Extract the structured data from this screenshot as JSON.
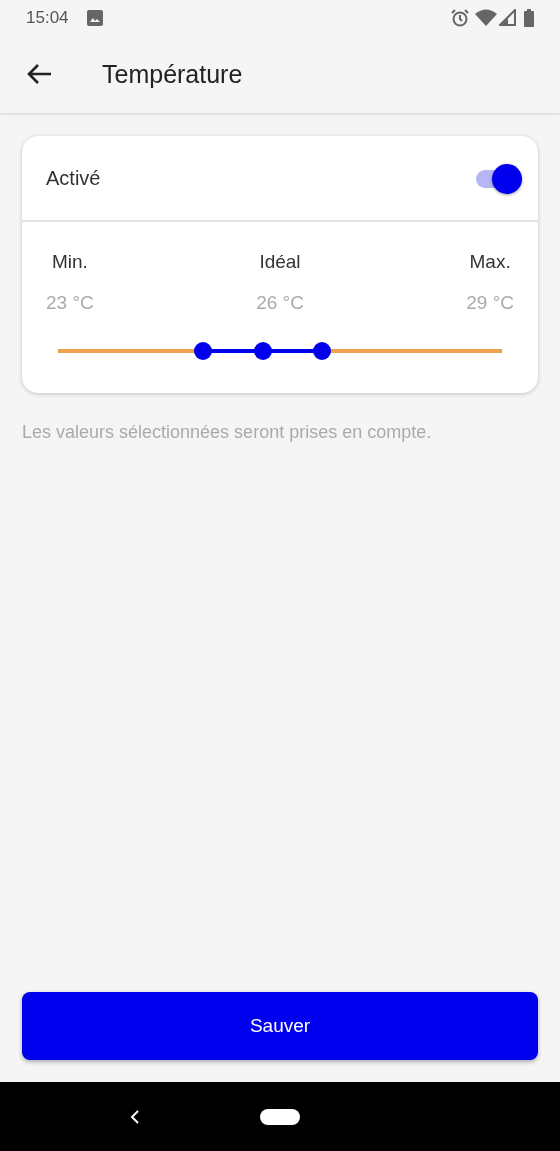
{
  "status_bar": {
    "time": "15:04"
  },
  "app_bar": {
    "title": "Température"
  },
  "toggle": {
    "label": "Activé",
    "on": true
  },
  "range": {
    "thumbs": [
      {
        "label": "Min.",
        "value": "23 °C",
        "level": 0.326
      },
      {
        "label": "Idéal",
        "value": "26 °C",
        "level": 0.4615
      },
      {
        "label": "Max.",
        "value": "29 °C",
        "level": 0.595
      }
    ]
  },
  "caption": "Les valeurs sélectionnées seront prises en compte.",
  "save_button": "Sauver"
}
